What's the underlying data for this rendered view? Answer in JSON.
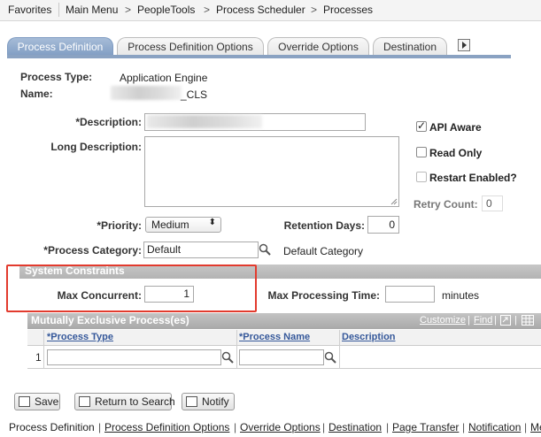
{
  "nav": {
    "favorites": "Favorites",
    "main_menu": "Main Menu",
    "peopletools": "PeopleTools",
    "scheduler": "Process Scheduler",
    "processes": "Processes"
  },
  "tabs": [
    "Process Definition",
    "Process Definition Options",
    "Override Options",
    "Destination"
  ],
  "header": {
    "process_type_label": "Process Type:",
    "process_type_value": "Application Engine",
    "name_label": "Name:",
    "name_suffix": "_CLS"
  },
  "fields": {
    "description_label": "*Description:",
    "long_description_label": "Long Description:",
    "priority_label": "*Priority:",
    "priority_value": "Medium",
    "retention_label": "Retention Days:",
    "retention_value": "0",
    "category_label": "*Process Category:",
    "category_value": "Default",
    "category_desc": "Default Category"
  },
  "options": {
    "api_aware": "API Aware",
    "read_only": "Read Only",
    "restart": "Restart Enabled?",
    "retry_label": "Retry Count:",
    "retry_value": "0"
  },
  "constraints": {
    "title": "System Constraints",
    "max_concurrent_label": "Max Concurrent:",
    "max_concurrent_value": "1",
    "max_time_label": "Max Processing Time:",
    "max_time_unit": "minutes"
  },
  "grid": {
    "title": "Mutually Exclusive Process(es)",
    "customize": "Customize",
    "find": "Find",
    "col_type": "*Process Type",
    "col_name": "*Process Name",
    "col_desc": "Description",
    "row_num": "1"
  },
  "buttons": {
    "save": "Save",
    "return": "Return to Search",
    "notify": "Notify"
  },
  "footer": [
    "Process Definition",
    "Process Definition Options",
    "Override Options",
    "Destination",
    "Page Transfer",
    "Notification",
    "Me"
  ]
}
